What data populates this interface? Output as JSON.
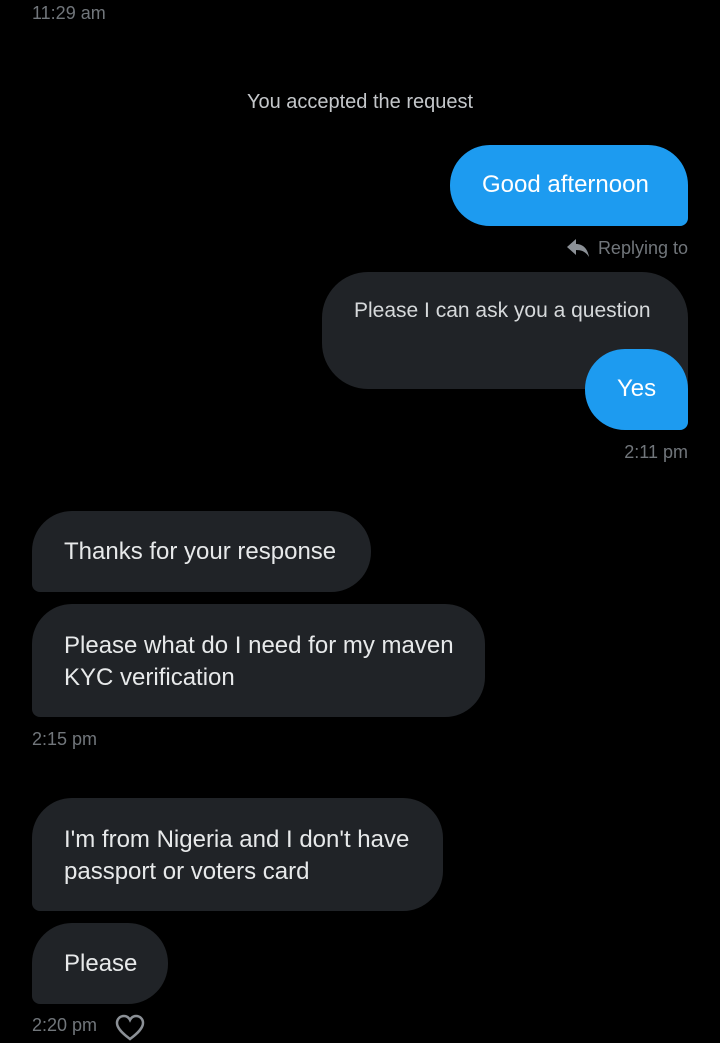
{
  "top_timestamp": "11:29 am",
  "system_notice": "You accepted the request",
  "messages": {
    "m1": "Good afternoon",
    "reply_indicator": "Replying to",
    "quoted": "Please I can ask you a question",
    "m2": "Yes",
    "ts1": "2:11 pm",
    "m3": "Thanks for your response",
    "m4_line1": "Please what do I need for my maven",
    "m4_line2": "KYC verification",
    "ts2": "2:15 pm",
    "m5_line1": "I'm from Nigeria and I don't have",
    "m5_line2": "passport or voters card",
    "m6": "Please",
    "ts3": "2:20 pm"
  },
  "icons": {
    "reply": "reply-arrow-icon",
    "react": "heart-plus-icon"
  },
  "colors": {
    "background": "#000000",
    "outgoing_bubble": "#1d9bf0",
    "incoming_bubble": "#202327",
    "muted_text": "#71767b"
  }
}
